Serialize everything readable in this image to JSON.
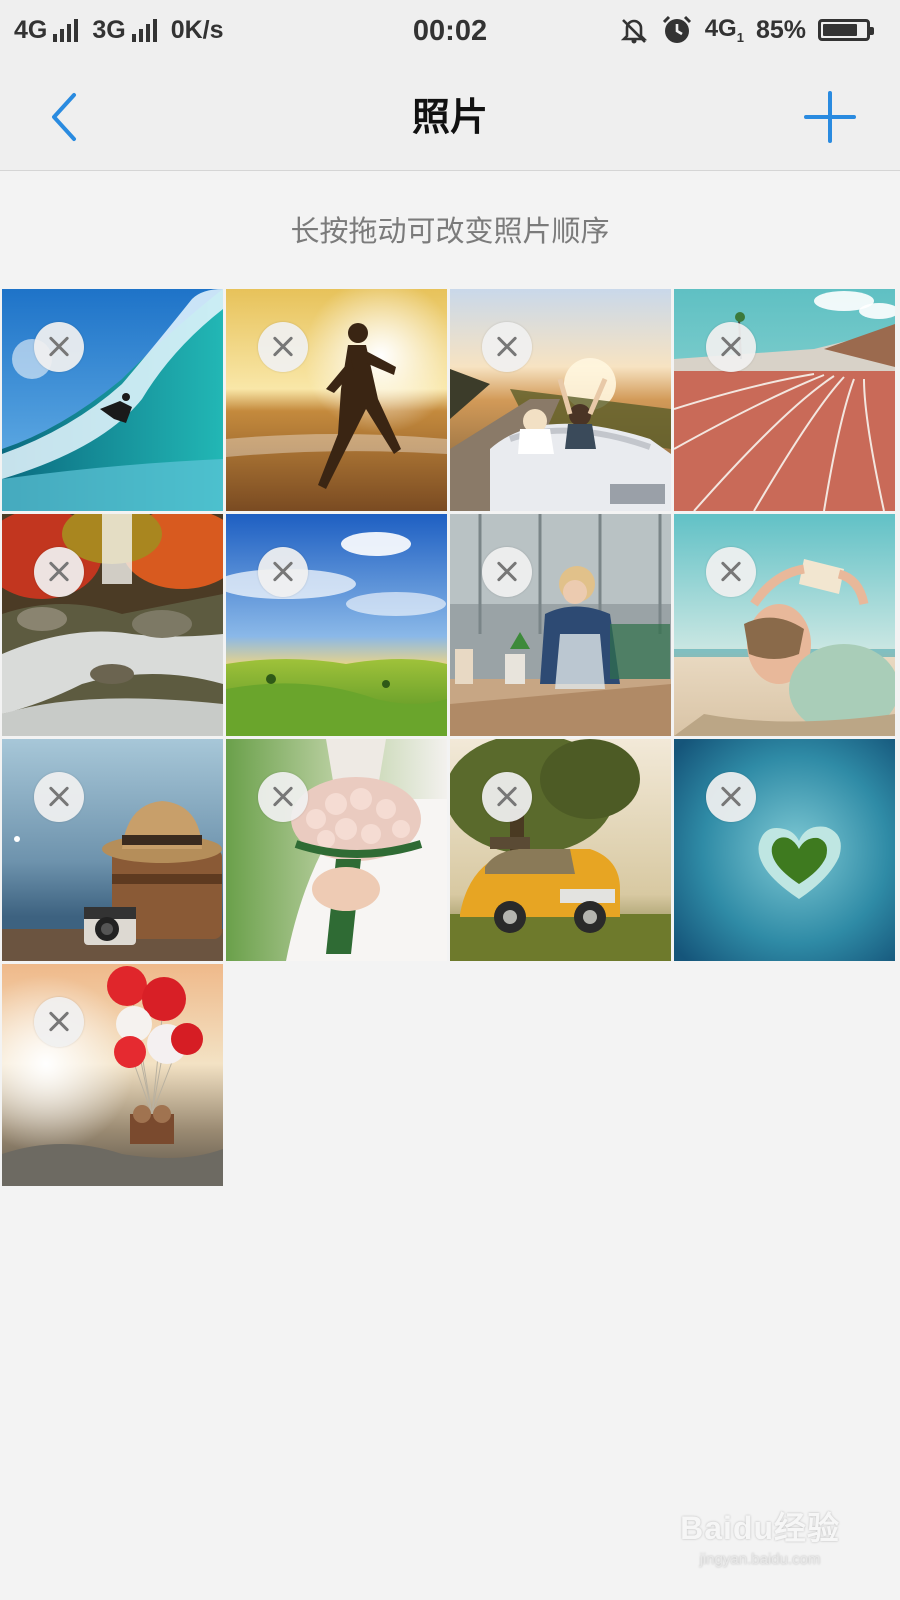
{
  "status_bar": {
    "network_1": "4G",
    "network_2": "3G",
    "speed": "0K/s",
    "time": "00:02",
    "data_network": "4G",
    "data_sim": "1",
    "battery_percent": "85%",
    "battery_level": 0.85,
    "icons": [
      "signal-icon",
      "signal-icon",
      "bell-off-icon",
      "alarm-icon",
      "battery-icon"
    ]
  },
  "nav": {
    "title": "照片",
    "back_icon": "chevron-left-icon",
    "add_icon": "plus-icon",
    "accent_color": "#2a8be0"
  },
  "hint": "长按拖动可改变照片顺序",
  "photos": [
    {
      "subject": "surfer-wave"
    },
    {
      "subject": "runner-sunset"
    },
    {
      "subject": "convertible-couple"
    },
    {
      "subject": "running-track"
    },
    {
      "subject": "autumn-waterfall"
    },
    {
      "subject": "green-hills-sky"
    },
    {
      "subject": "woman-cafe"
    },
    {
      "subject": "woman-reading-beach"
    },
    {
      "subject": "hat-camera-suitcase"
    },
    {
      "subject": "bride-bouquet"
    },
    {
      "subject": "yellow-car-tree"
    },
    {
      "subject": "heart-island"
    },
    {
      "subject": "balloons-teddy-bears"
    }
  ],
  "delete_icon": "close-icon",
  "watermark": {
    "main": "Baidu经验",
    "sub": "jingyan.baidu.com"
  }
}
